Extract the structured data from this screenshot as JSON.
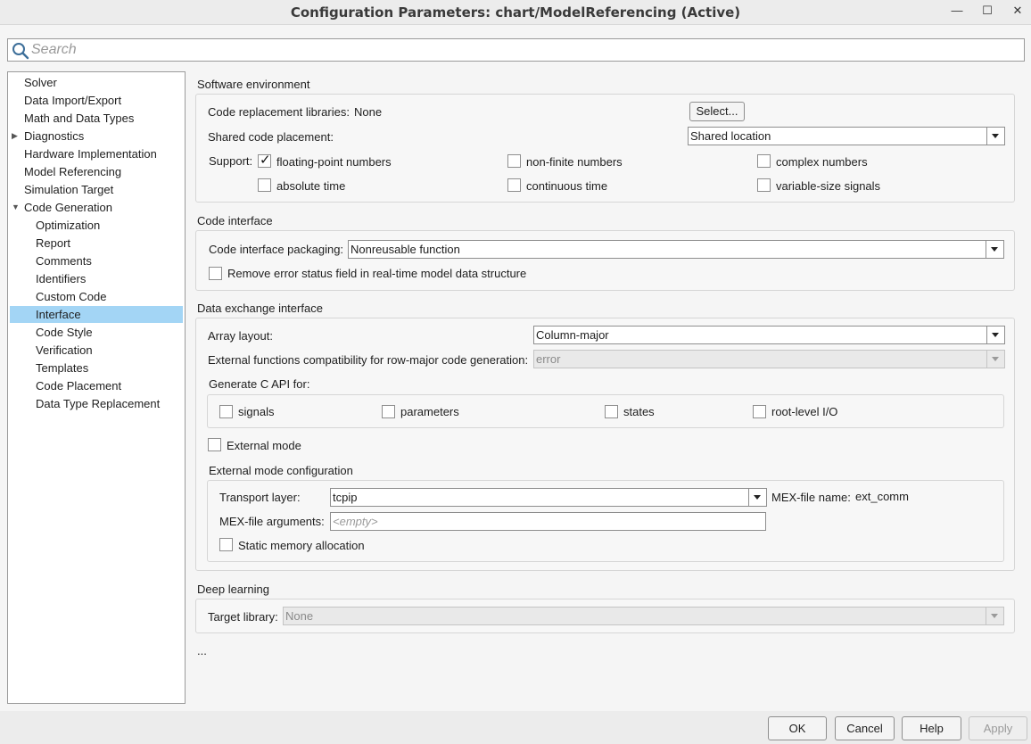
{
  "window": {
    "title": "Configuration Parameters: chart/ModelReferencing (Active)",
    "minimize_glyph": "—",
    "maximize_glyph": "☐",
    "close_glyph": "✕"
  },
  "search": {
    "placeholder": "Search",
    "value": ""
  },
  "tree": {
    "items": [
      {
        "label": "Solver"
      },
      {
        "label": "Data Import/Export"
      },
      {
        "label": "Math and Data Types"
      },
      {
        "label": "Diagnostics",
        "expander": "collapsed"
      },
      {
        "label": "Hardware Implementation"
      },
      {
        "label": "Model Referencing"
      },
      {
        "label": "Simulation Target"
      },
      {
        "label": "Code Generation",
        "expander": "expanded"
      },
      {
        "label": "Optimization"
      },
      {
        "label": "Report"
      },
      {
        "label": "Comments"
      },
      {
        "label": "Identifiers"
      },
      {
        "label": "Custom Code"
      },
      {
        "label": "Interface",
        "selected": true
      },
      {
        "label": "Code Style"
      },
      {
        "label": "Verification"
      },
      {
        "label": "Templates"
      },
      {
        "label": "Code Placement"
      },
      {
        "label": "Data Type Replacement"
      }
    ]
  },
  "software_environment": {
    "title": "Software environment",
    "code_replacement_label": "Code replacement libraries:",
    "code_replacement_value": "None",
    "select_button": "Select...",
    "shared_code_label": "Shared code placement:",
    "shared_code_value": "Shared location",
    "support_label": "Support:",
    "checkboxes": [
      {
        "label": "floating-point numbers",
        "checked": true
      },
      {
        "label": "non-finite numbers",
        "checked": false
      },
      {
        "label": "complex numbers",
        "checked": false
      },
      {
        "label": "absolute time",
        "checked": false
      },
      {
        "label": "continuous time",
        "checked": false
      },
      {
        "label": "variable-size signals",
        "checked": false
      }
    ]
  },
  "code_interface": {
    "title": "Code interface",
    "packaging_label": "Code interface packaging:",
    "packaging_value": "Nonreusable function",
    "remove_error_label": "Remove error status field in real-time model data structure",
    "remove_error_checked": false
  },
  "data_exchange": {
    "title": "Data exchange interface",
    "array_layout_label": "Array layout:",
    "array_layout_value": "Column-major",
    "ext_func_label": "External functions compatibility for row-major code generation:",
    "ext_func_value": "error",
    "c_api_label": "Generate C API for:",
    "c_api": [
      {
        "label": "signals",
        "checked": false
      },
      {
        "label": "parameters",
        "checked": false
      },
      {
        "label": "states",
        "checked": false
      },
      {
        "label": "root-level I/O",
        "checked": false
      }
    ],
    "external_mode_label": "External mode",
    "external_mode_checked": false,
    "ext_config_title": "External mode configuration",
    "transport_label": "Transport layer:",
    "transport_value": "tcpip",
    "mex_name_label": "MEX-file name:",
    "mex_name_value": "ext_comm",
    "mex_args_label": "MEX-file arguments:",
    "mex_args_placeholder": "<empty>",
    "static_mem_label": "Static memory allocation",
    "static_mem_checked": false
  },
  "deep_learning": {
    "title": "Deep learning",
    "target_library_label": "Target library:",
    "target_library_value": "None"
  },
  "ellipsis": "...",
  "footer": {
    "ok": "OK",
    "cancel": "Cancel",
    "help": "Help",
    "apply": "Apply"
  }
}
